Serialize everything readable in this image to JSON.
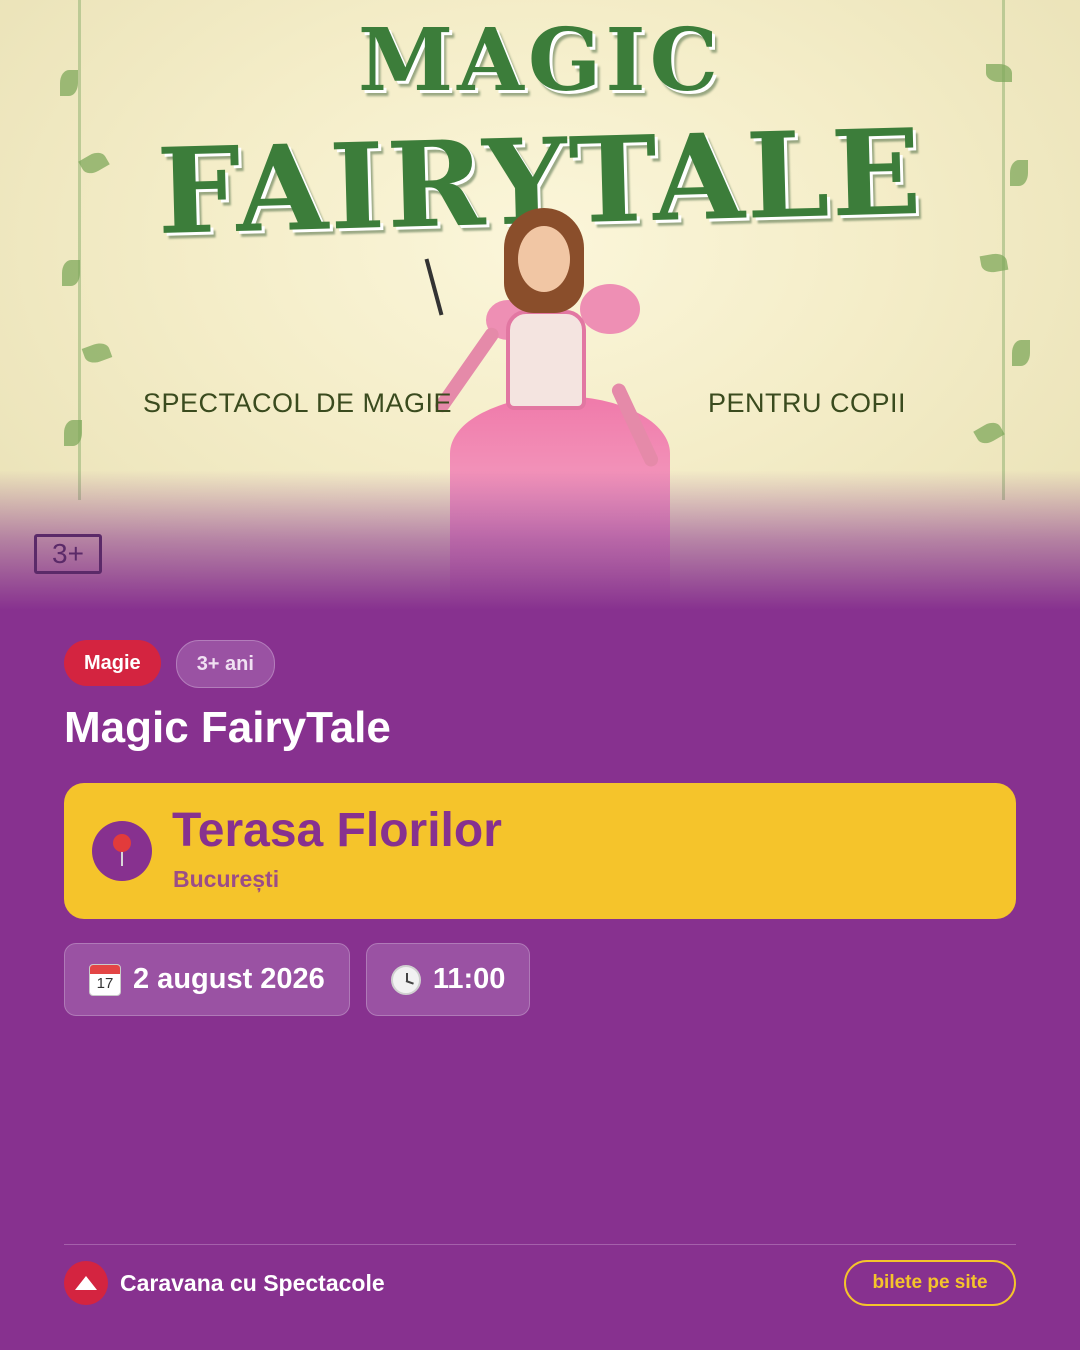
{
  "poster": {
    "title_line1": "MAGIC",
    "title_line2": "FAIRYTALE",
    "subtitle_left": "SPECTACOL DE MAGIE",
    "subtitle_right": "PENTRU COPII",
    "age_badge": "3+"
  },
  "event": {
    "category_tag": "Magie",
    "age_tag": "3+ ani",
    "title": "Magic FairyTale"
  },
  "venue": {
    "icon": "pin-icon",
    "name": "Terasa Florilor",
    "city": "București"
  },
  "schedule": {
    "date_icon": "calendar-icon",
    "calendar_day": "17",
    "date": "2 august 2026",
    "time_icon": "clock-icon",
    "time": "11:00"
  },
  "footer": {
    "logo_icon": "circus-tent-icon",
    "brand": "Caravana cu Spectacole",
    "ticket_button": "bilete pe site"
  },
  "colors": {
    "background": "#87318f",
    "accent_yellow": "#f5c42b",
    "accent_red": "#d42440",
    "text_white": "#ffffff"
  }
}
